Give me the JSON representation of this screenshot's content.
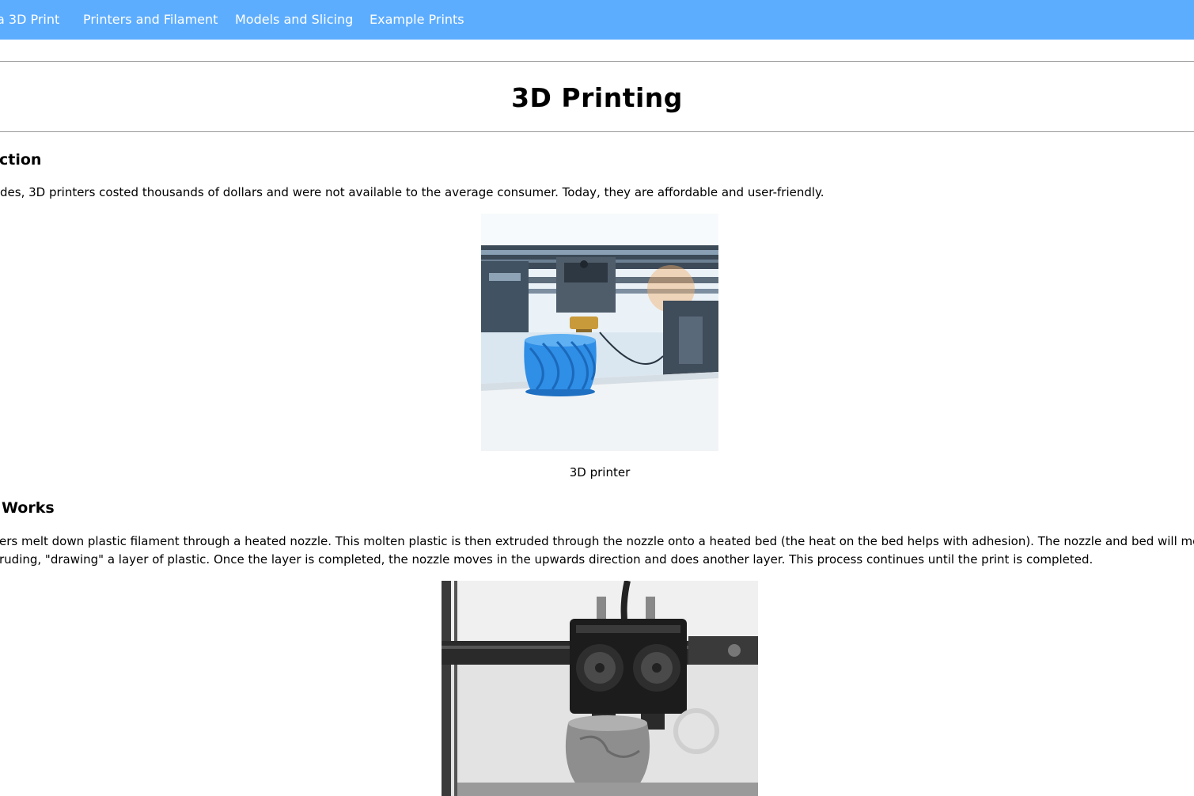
{
  "nav": {
    "items": [
      {
        "label": "a 3D Print"
      },
      {
        "label": "Printers and Filament"
      },
      {
        "label": "Models and Slicing"
      },
      {
        "label": "Example Prints"
      }
    ]
  },
  "page": {
    "title": "3D Printing"
  },
  "sections": {
    "intro": {
      "heading": "ction",
      "text": "des, 3D printers costed thousands of dollars and were not available to the average consumer. Today, they are affordable and user-friendly.",
      "image_caption": "3D printer"
    },
    "works": {
      "heading": "Works",
      "text_line1": "ers melt down plastic filament through a heated nozzle. This molten plastic is then extruded through the nozzle onto a heated bed (the heat on the bed helps with adhesion). The nozzle and bed will move",
      "text_line2": "ruding, \"drawing\" a layer of plastic. Once the layer is completed, the nozzle moves in the upwards direction and does another layer. This process continues until the print is completed."
    }
  },
  "colors": {
    "navbar": "#5dadff",
    "nav_text": "#ffffff",
    "rule": "#9a9a9a",
    "vase": "#2f8ee6"
  }
}
